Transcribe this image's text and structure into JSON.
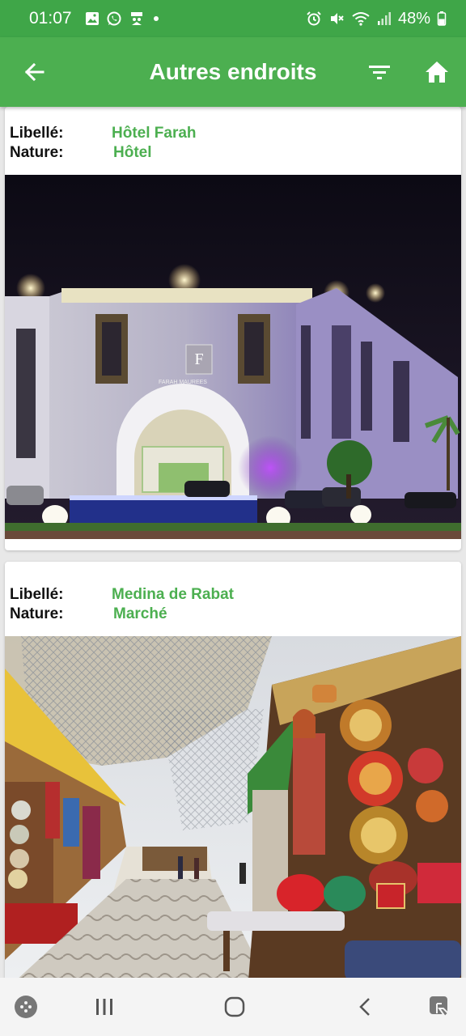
{
  "status_bar": {
    "time": "01:07",
    "battery": "48%",
    "icons_left": [
      "gallery-icon",
      "whatsapp-icon",
      "app-icon",
      "dot-icon"
    ],
    "icons_right": [
      "alarm-icon",
      "mute-icon",
      "wifi-icon",
      "signal-icon",
      "battery-icon"
    ]
  },
  "app_bar": {
    "title": "Autres endroits",
    "back_icon": "arrow-left-icon",
    "filter_icon": "filter-icon",
    "home_icon": "home-icon"
  },
  "places": [
    {
      "label_key": "Libellé:",
      "label_value": "Hôtel Farah",
      "nature_key": "Nature:",
      "nature_value": "Hôtel",
      "sign_text": "FARAH MAUREES"
    },
    {
      "label_key": "Libellé:",
      "label_value": "Medina de Rabat",
      "nature_key": "Nature:",
      "nature_value": "Marché"
    }
  ],
  "nav_bar": {
    "icons": [
      "game-launcher-icon",
      "recents-icon",
      "home-circle-icon",
      "back-chevron-icon",
      "accessibility-icon"
    ]
  },
  "colors": {
    "primary": "#4caf50",
    "status_bar": "#3fa648"
  }
}
